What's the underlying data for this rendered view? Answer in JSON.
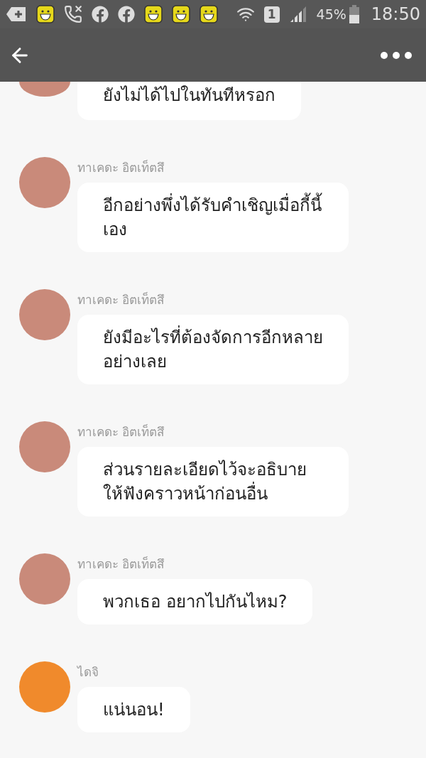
{
  "status_bar": {
    "sim": "1",
    "battery": "45%",
    "time": "18:50"
  },
  "messages": [
    {
      "kind": "cut",
      "color": "#c98a7a",
      "text": "ยังไม่ได้ไปในทันทีหรอก"
    },
    {
      "sender": "ทาเคดะ อิตเท็ตสึ",
      "color": "#c98a7a",
      "text": "อีกอย่างพึ่งได้รับคำเชิญเมื่อกี้นี้เอง"
    },
    {
      "sender": "ทาเคดะ อิตเท็ตสึ",
      "color": "#c98a7a",
      "text": "ยังมีอะไรที่ต้องจัดการอีกหลายอย่างเลย"
    },
    {
      "sender": "ทาเคดะ อิตเท็ตสึ",
      "color": "#c98a7a",
      "text": "ส่วนรายละเอียดไว้จะอธิบายให้ฟังคราวหน้าก่อนอื่น"
    },
    {
      "sender": "ทาเคดะ อิตเท็ตสึ",
      "color": "#c98a7a",
      "text": "พวกเธอ อยากไปกันไหม?"
    },
    {
      "sender": "ไดจิ",
      "color": "#f08a2c",
      "text": "แน่นอน!"
    }
  ]
}
